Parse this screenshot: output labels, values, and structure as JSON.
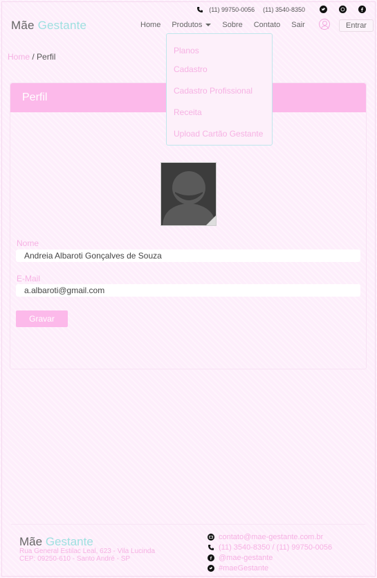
{
  "topbar": {
    "phone_mobile": "(11) 99750-0056",
    "phone_landline": "(11) 3540-8350"
  },
  "brand": {
    "part1": "Mãe",
    "part2": "Gestante"
  },
  "nav": {
    "home": "Home",
    "products": "Produtos",
    "about": "Sobre",
    "contact": "Contato",
    "logout": "Sair",
    "login": "Entrar"
  },
  "products_menu": [
    "Planos",
    "Cadastro",
    "Cadastro Profissional",
    "Receita",
    "Upload Cartão Gestante"
  ],
  "breadcrumb": {
    "home": "Home",
    "separator": "/",
    "current": "Perfil"
  },
  "profile": {
    "title": "Perfil",
    "name_label": "Nome",
    "name_value": "Andreia Albaroti Gonçalves de Souza",
    "email_label": "E-Mail",
    "email_value": "a.albaroti@gmail.com",
    "save_label": "Gravar"
  },
  "footer": {
    "brand1": "Mãe",
    "brand2": "Gestante",
    "address1": "Rua General Estilac Leal, 623 - Vila Lucinda",
    "address2": "CEP: 09250-610 - Santo André - SP",
    "email": "contato@mae-gestante.com.br",
    "phones": "(11) 3540-8350 / (11) 99750-0056",
    "facebook": "@mae-gestante",
    "twitter": "#maeGestante"
  },
  "colors": {
    "accent": "#fcb9ea",
    "link": "#f6b1e3",
    "brand_teal": "#9ee0e0"
  }
}
